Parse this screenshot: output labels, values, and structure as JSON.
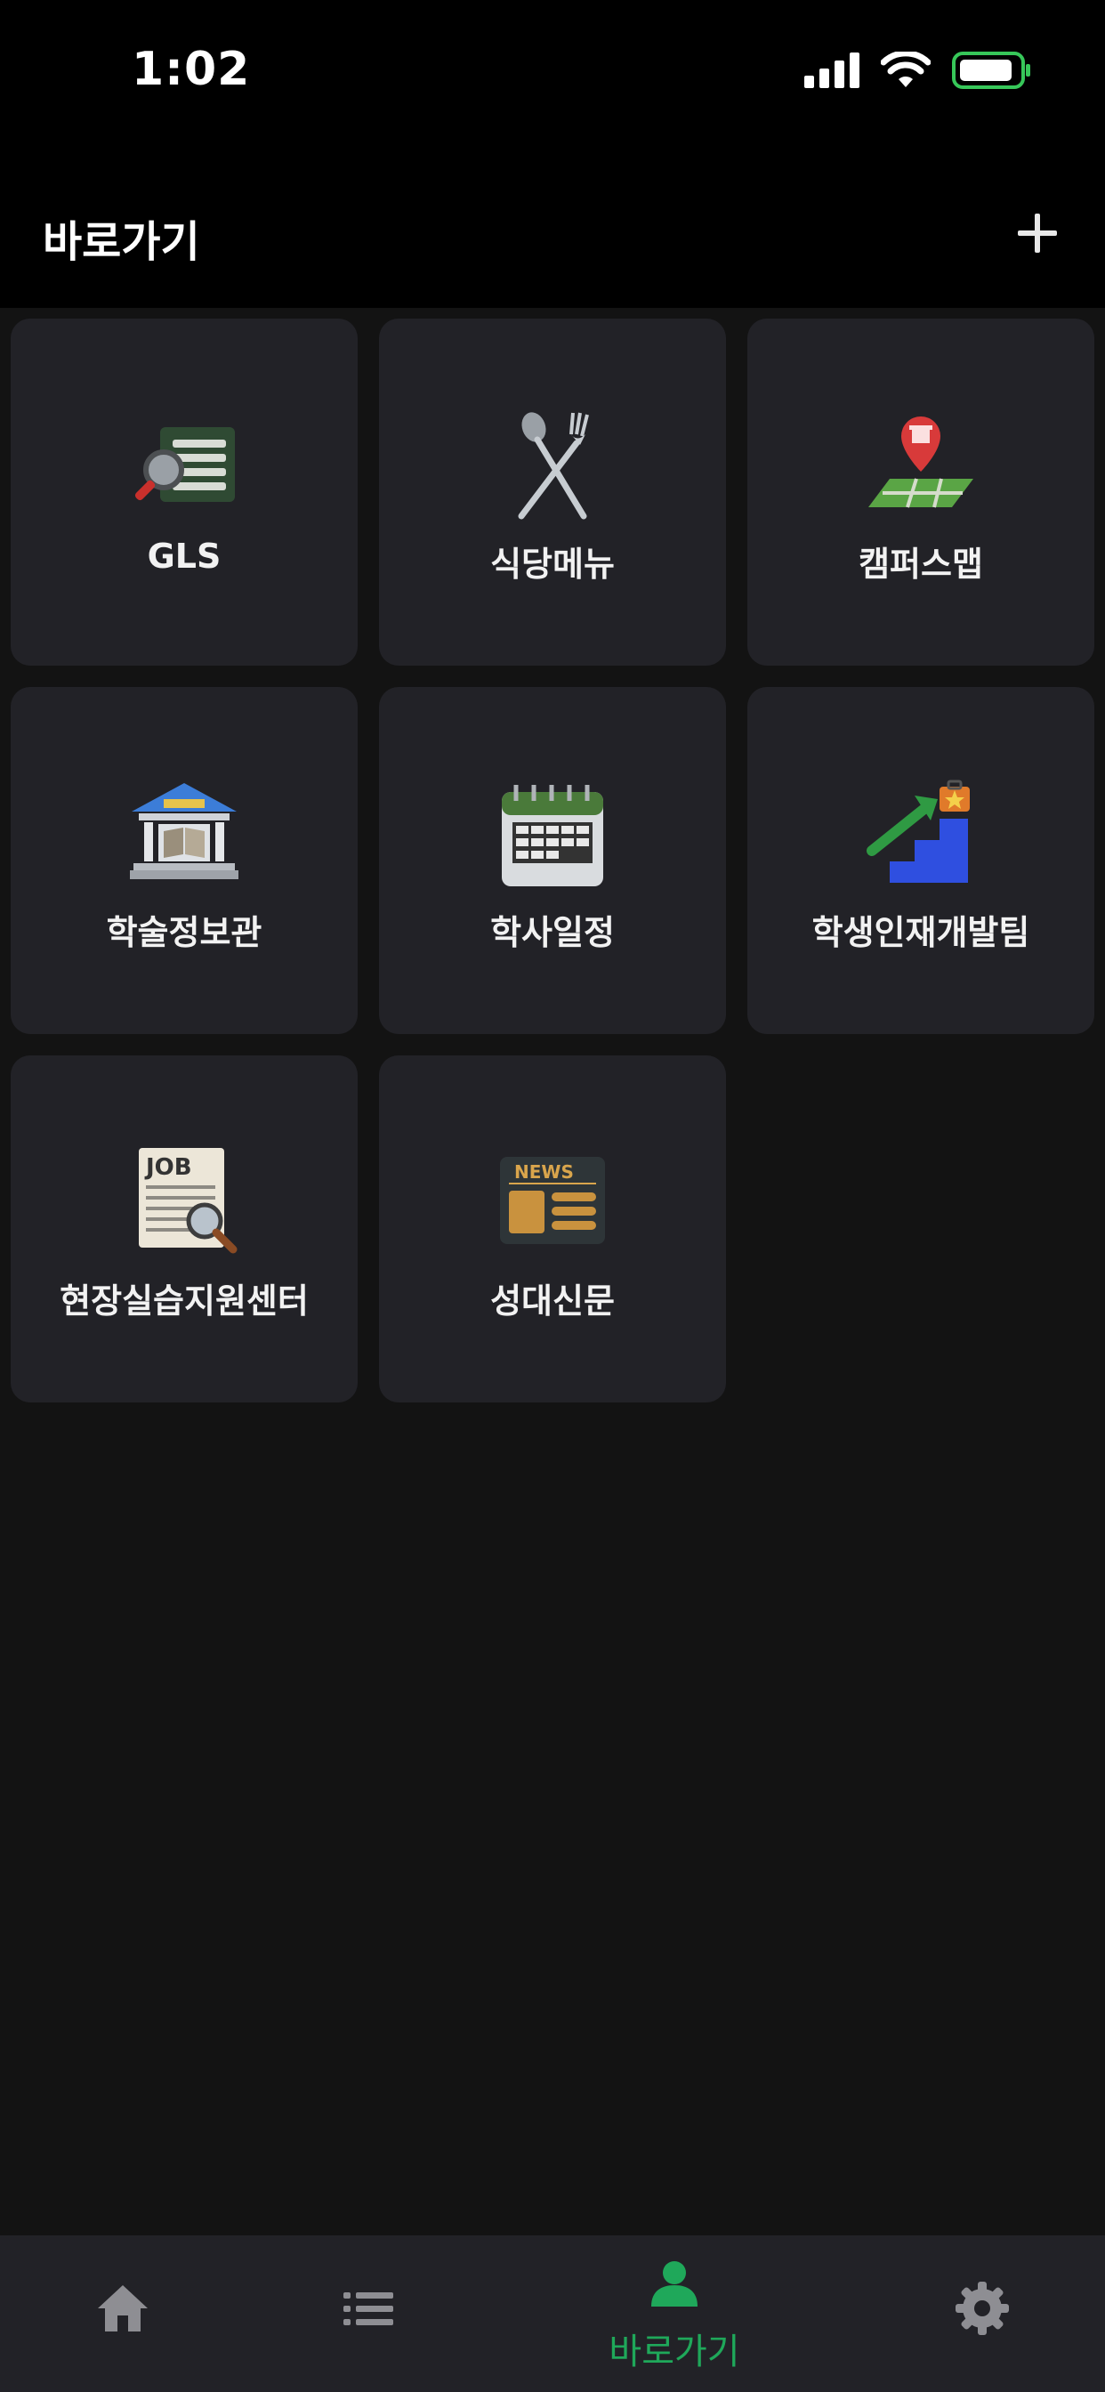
{
  "status_bar": {
    "time": "1:02"
  },
  "header": {
    "title": "바로가기",
    "add_icon": "plus-icon"
  },
  "tiles": [
    {
      "label": "GLS",
      "icon": "document-search-icon"
    },
    {
      "label": "식당메뉴",
      "icon": "fork-spoon-icon"
    },
    {
      "label": "캠퍼스맵",
      "icon": "map-pin-icon"
    },
    {
      "label": "학술정보관",
      "icon": "library-icon"
    },
    {
      "label": "학사일정",
      "icon": "calendar-icon"
    },
    {
      "label": "학생인재개발팀",
      "icon": "career-stairs-icon"
    },
    {
      "label": "현장실습지원센터",
      "icon": "job-search-icon"
    },
    {
      "label": "성대신문",
      "icon": "newspaper-icon"
    }
  ],
  "tabbar": {
    "items": [
      {
        "label": "",
        "icon": "home-icon"
      },
      {
        "label": "",
        "icon": "list-icon"
      },
      {
        "label": "바로가기",
        "icon": "person-icon",
        "active": true
      },
      {
        "label": "",
        "icon": "gear-icon"
      }
    ],
    "active_color": "#1fa85a",
    "inactive_color": "#8e8e93"
  }
}
